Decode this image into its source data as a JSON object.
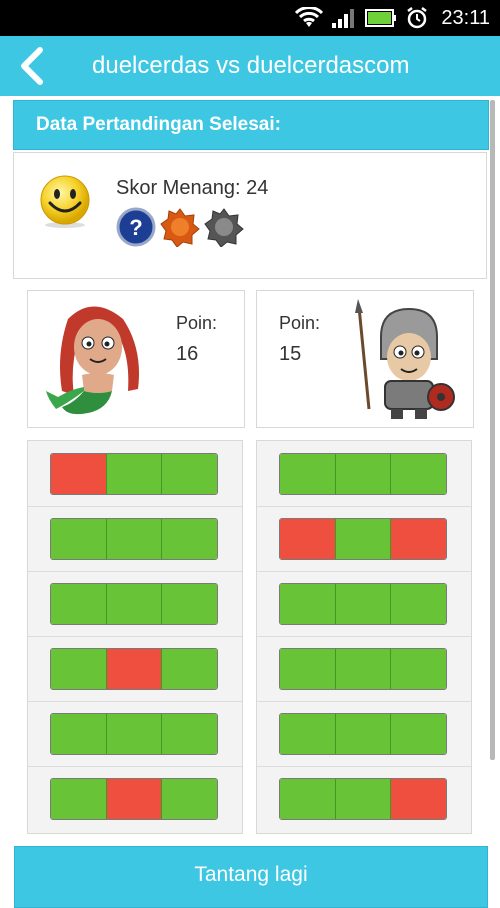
{
  "status_bar": {
    "time": "23:11"
  },
  "app_bar": {
    "title": "duelcerdas vs duelcerdascom"
  },
  "header": {
    "title": "Data Pertandingan Selesai:"
  },
  "summary": {
    "score_label": "Skor Menang: 24",
    "badges": [
      "question-badge",
      "bronze-badge",
      "gray-badge"
    ]
  },
  "players": [
    {
      "avatar": "mermaid-avatar",
      "points_label": "Poin:",
      "points_value": "16"
    },
    {
      "avatar": "knight-avatar",
      "points_label": "Poin:",
      "points_value": "15"
    }
  ],
  "rounds": {
    "left": [
      [
        "red",
        "green",
        "green"
      ],
      [
        "green",
        "green",
        "green"
      ],
      [
        "green",
        "green",
        "green"
      ],
      [
        "green",
        "red",
        "green"
      ],
      [
        "green",
        "green",
        "green"
      ],
      [
        "green",
        "red",
        "green"
      ]
    ],
    "right": [
      [
        "green",
        "green",
        "green"
      ],
      [
        "red",
        "green",
        "red"
      ],
      [
        "green",
        "green",
        "green"
      ],
      [
        "green",
        "green",
        "green"
      ],
      [
        "green",
        "green",
        "green"
      ],
      [
        "green",
        "green",
        "red"
      ]
    ]
  },
  "cta": {
    "label": "Tantang lagi"
  },
  "colors": {
    "accent": "#3ec7e3",
    "correct": "#68c436",
    "wrong": "#ef4f3e"
  }
}
